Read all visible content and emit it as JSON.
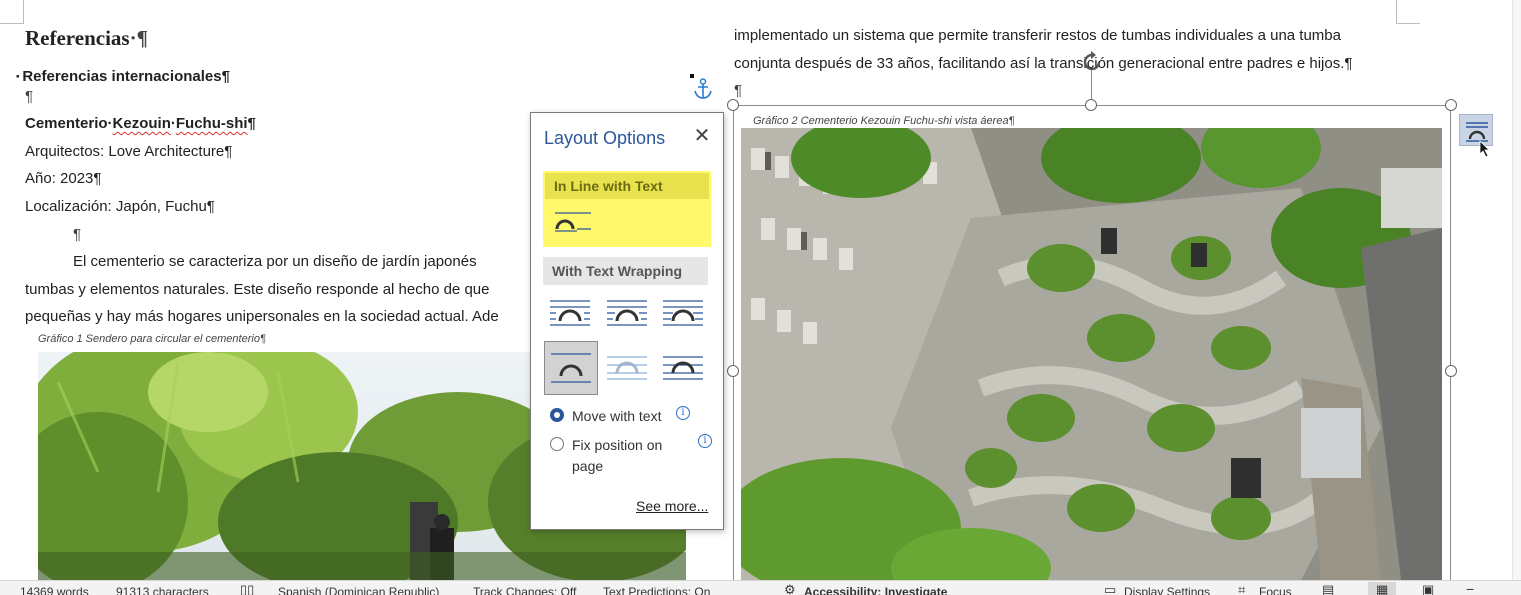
{
  "left_column": {
    "heading": "Referencias",
    "subheading": "Referencias internacionales",
    "project_title": "Cementerio Kezouin Fuchu-shi",
    "architects": "Arquitectos: Love Architecture",
    "year": "Año: 2023",
    "location": "Localización: Japón, Fuchu",
    "para_line1": "El cementerio se caracteriza por un diseño de jardín japonés",
    "para_line2": "tumbas y elementos naturales. Este diseño responde al hecho de que",
    "para_line3": "pequeñas y hay más hogares unipersonales en la sociedad actual. Ade",
    "caption1": "Gráfico 1 Sendero para circular el cementerio",
    "pilcrow": "¶"
  },
  "right_column": {
    "line1": "implementado un sistema que permite transferir restos de tumbas individuales a una tumba",
    "line2": "conjunta después de 33 años, facilitando así la transición generacional entre padres e hijos.",
    "caption2": "Gráfico 2 Cementerio Kezouin Fuchu-shi vista áerea"
  },
  "layout_options": {
    "title": "Layout Options",
    "close_label": "✕",
    "inline_header": "In Line with Text",
    "wrapping_header": "With Text Wrapping",
    "move_with_text": "Move with text",
    "fix_position": "Fix position on",
    "fix_position_line2": "page",
    "see_more": "See more...",
    "info_glyph": "i"
  },
  "status_bar": {
    "words": "14369 words",
    "characters": "91313 characters",
    "language": "Spanish (Dominican Republic)",
    "track_changes": "Track Changes: Off",
    "text_predictions": "Text Predictions: On",
    "accessibility": "Accessibility: Investigate",
    "display_settings": "Display Settings",
    "focus": "Focus"
  },
  "colors": {
    "accent": "#2b579a",
    "highlight": "#fff96b",
    "highlight_header": "#e9e24f",
    "spell_error": "#dd3333"
  },
  "icons": [
    "anchor-icon",
    "rotate-handle-icon",
    "layout-options-icon",
    "mouse-cursor-icon",
    "close-icon",
    "info-icon"
  ]
}
